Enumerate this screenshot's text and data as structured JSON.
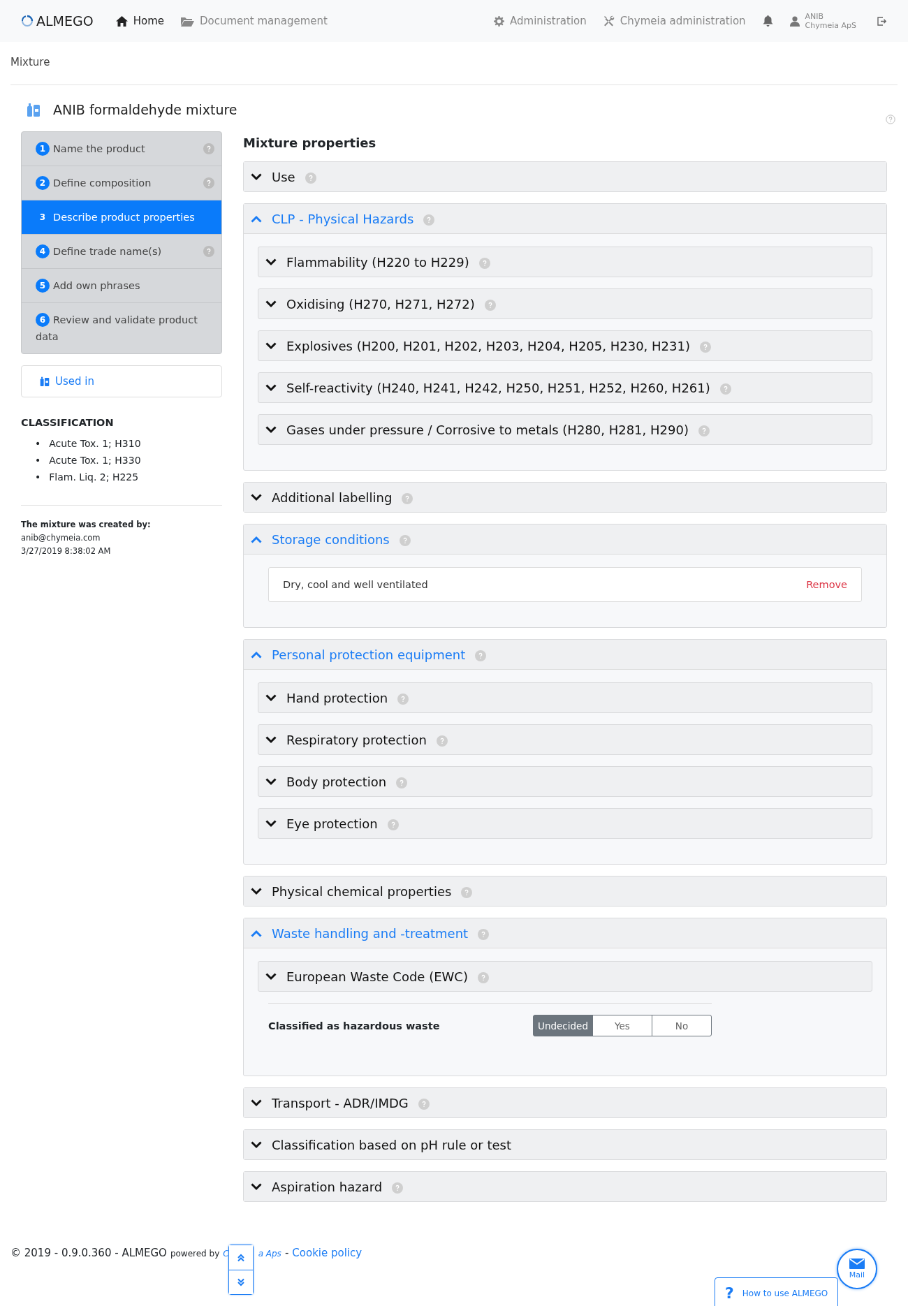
{
  "navbar": {
    "logo": "ALMEGO",
    "links": [
      {
        "label": "Home",
        "selected": true
      },
      {
        "label": "Document management",
        "selected": false
      }
    ],
    "right_links": [
      {
        "label": "Administration"
      },
      {
        "label": "Chymeia administration"
      }
    ],
    "user": {
      "name": "ANIB",
      "company": "Chymeia ApS"
    }
  },
  "breadcrumb": "Mixture",
  "title": "ANIB formaldehyde mixture",
  "steps": [
    {
      "number": "1",
      "label": "Name the product",
      "selected": false,
      "help": true
    },
    {
      "number": "2",
      "label": "Define composition",
      "selected": false,
      "help": true
    },
    {
      "number": "3",
      "label": "Describe product properties",
      "selected": true,
      "help": false
    },
    {
      "number": "4",
      "label": "Define trade name(s)",
      "selected": false,
      "help": true
    },
    {
      "number": "5",
      "label": "Add own phrases",
      "selected": false,
      "help": false
    },
    {
      "number": "6",
      "label": "Review and validate product data",
      "selected": false,
      "help": false
    }
  ],
  "used_in": "Used in",
  "classification": {
    "heading": "CLASSIFICATION",
    "items": [
      {
        "marker": "•",
        "text": "Acute Tox. 1; H310"
      },
      {
        "marker": "•",
        "text": "Acute Tox. 1; H330"
      },
      {
        "marker": "•",
        "text": "Flam. Liq. 2; H225"
      }
    ]
  },
  "created": {
    "heading": "The mixture was created by:",
    "email": "anib@chymeia.com",
    "date": "3/27/2019 8:38:02 AM"
  },
  "properties_heading": "Mixture properties",
  "sections": [
    {
      "title": "Use",
      "expanded": false,
      "help": true
    },
    {
      "title": "CLP - Physical Hazards",
      "expanded": true,
      "help": true,
      "subsections": [
        {
          "title": "Flammability (H220 to H229)"
        },
        {
          "title": "Oxidising (H270, H271, H272)"
        },
        {
          "title": "Explosives (H200, H201, H202, H203, H204, H205, H230, H231)"
        },
        {
          "title": "Self-reactivity (H240, H241, H242, H250, H251, H252, H260, H261)"
        },
        {
          "title": "Gases under pressure / Corrosive to metals (H280, H281, H290)"
        }
      ]
    },
    {
      "title": "Additional labelling",
      "expanded": false,
      "help": true
    },
    {
      "title": "Storage conditions",
      "expanded": true,
      "help": true,
      "phrases": [
        {
          "text": "Dry, cool and well ventilated",
          "action": "Remove"
        }
      ]
    },
    {
      "title": "Personal protection equipment",
      "expanded": true,
      "help": true,
      "subsections": [
        {
          "title": "Hand protection"
        },
        {
          "title": "Respiratory protection"
        },
        {
          "title": "Body protection"
        },
        {
          "title": "Eye protection"
        }
      ]
    },
    {
      "title": "Physical chemical properties",
      "expanded": false,
      "help": true
    },
    {
      "title": "Waste handling and -treatment",
      "expanded": true,
      "help": true,
      "subsections": [
        {
          "title": "European Waste Code (EWC)"
        }
      ],
      "toggle": {
        "label": "Classified as hazardous waste",
        "options": [
          {
            "label": "Undecided",
            "selected": true
          },
          {
            "label": "Yes",
            "selected": false
          },
          {
            "label": "No",
            "selected": false
          }
        ]
      }
    },
    {
      "title": "Transport - ADR/IMDG",
      "expanded": false,
      "help": true
    },
    {
      "title": "Classification based on pH rule or test",
      "expanded": false,
      "help": false
    },
    {
      "title": "Aspiration hazard",
      "expanded": false,
      "help": true
    }
  ],
  "footer": {
    "copyright": "© 2019 - 0.9.0.360 - ALMEGO",
    "powered": "powered by",
    "link_start": "C",
    "link_end": "a Aps",
    "separator": "-",
    "cookie": "Cookie policy"
  },
  "mail": "Mail",
  "help_tab": {
    "icon": "?",
    "label": "How to use ALMEGO"
  }
}
